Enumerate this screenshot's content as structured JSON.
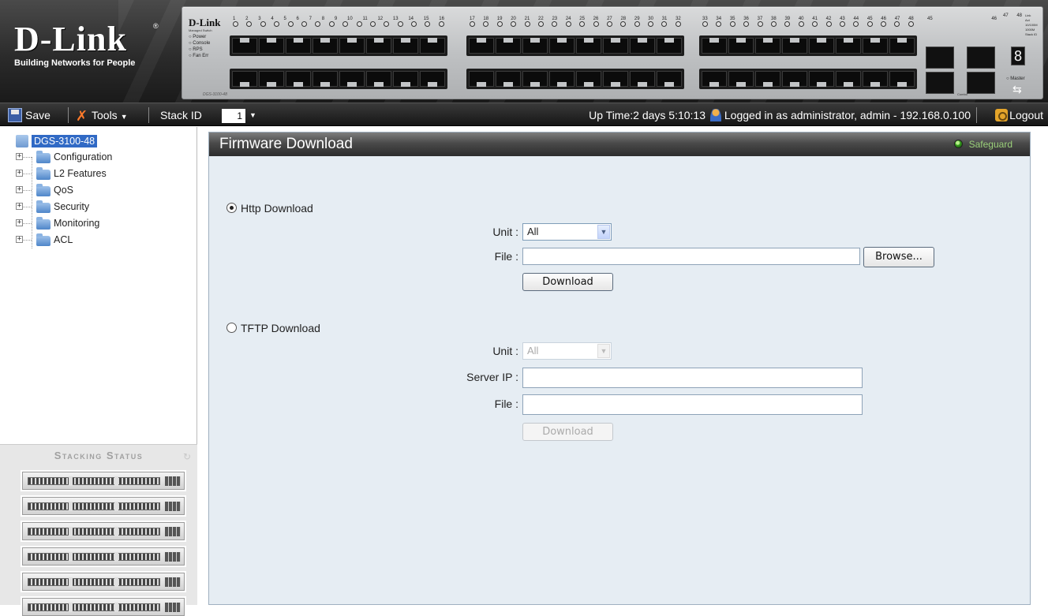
{
  "banner": {
    "logo": "D-Link",
    "tagline": "Building Networks for People",
    "device": {
      "brand": "D-Link",
      "subtitle": "Managed Switch",
      "leds": [
        "Power",
        "Console",
        "RPS",
        "Fan Err"
      ],
      "model": "DGS-3100-48",
      "port_banks": [
        [
          "1",
          "2",
          "3",
          "4",
          "5",
          "6",
          "7",
          "8",
          "9",
          "10",
          "11",
          "12",
          "13",
          "14",
          "15",
          "16"
        ],
        [
          "17",
          "18",
          "19",
          "20",
          "21",
          "22",
          "23",
          "24",
          "25",
          "26",
          "27",
          "28",
          "29",
          "30",
          "31",
          "32"
        ],
        [
          "33",
          "34",
          "35",
          "36",
          "37",
          "38",
          "39",
          "40",
          "41",
          "42",
          "43",
          "44",
          "45",
          "46",
          "47",
          "48"
        ]
      ],
      "combo_label": "Combo",
      "combo_ports": [
        "45",
        "46",
        "47",
        "48"
      ],
      "stack_digit": "8",
      "master_label": "Master",
      "status_legend": [
        "Link",
        "Act",
        "10/100M",
        "1000M",
        "Stack ID"
      ]
    }
  },
  "toolbar": {
    "save_label": "Save",
    "tools_label": "Tools",
    "stack_id_label": "Stack ID",
    "stack_id_value": "1",
    "uptime": "Up Time:2 days 5:10:13",
    "logged_in": "Logged in as administrator, admin - 192.168.0.100",
    "logout_label": "Logout"
  },
  "tree": {
    "root": "DGS-3100-48",
    "items": [
      {
        "label": "Configuration"
      },
      {
        "label": "L2 Features"
      },
      {
        "label": "QoS"
      },
      {
        "label": "Security"
      },
      {
        "label": "Monitoring"
      },
      {
        "label": "ACL"
      }
    ]
  },
  "stacking_status": {
    "title": "Stacking Status",
    "unit_count": 6
  },
  "main": {
    "title": "Firmware Download",
    "safeguard_label": "Safeguard",
    "http": {
      "radio_label": "Http Download",
      "selected": true,
      "unit_label": "Unit :",
      "unit_value": "All",
      "file_label": "File :",
      "file_value": "",
      "browse_label": "Browse...",
      "download_label": "Download"
    },
    "tftp": {
      "radio_label": "TFTP Download",
      "selected": false,
      "unit_label": "Unit :",
      "unit_value": "All",
      "server_ip_label": "Server IP :",
      "server_ip_value": "",
      "file_label": "File :",
      "file_value": "",
      "download_label": "Download"
    }
  },
  "colors": {
    "tree_selected_bg": "#316ac5",
    "content_bg": "#e6edf3",
    "header_bar": "#3a3a3a",
    "safeguard_green": "#3aa020"
  }
}
